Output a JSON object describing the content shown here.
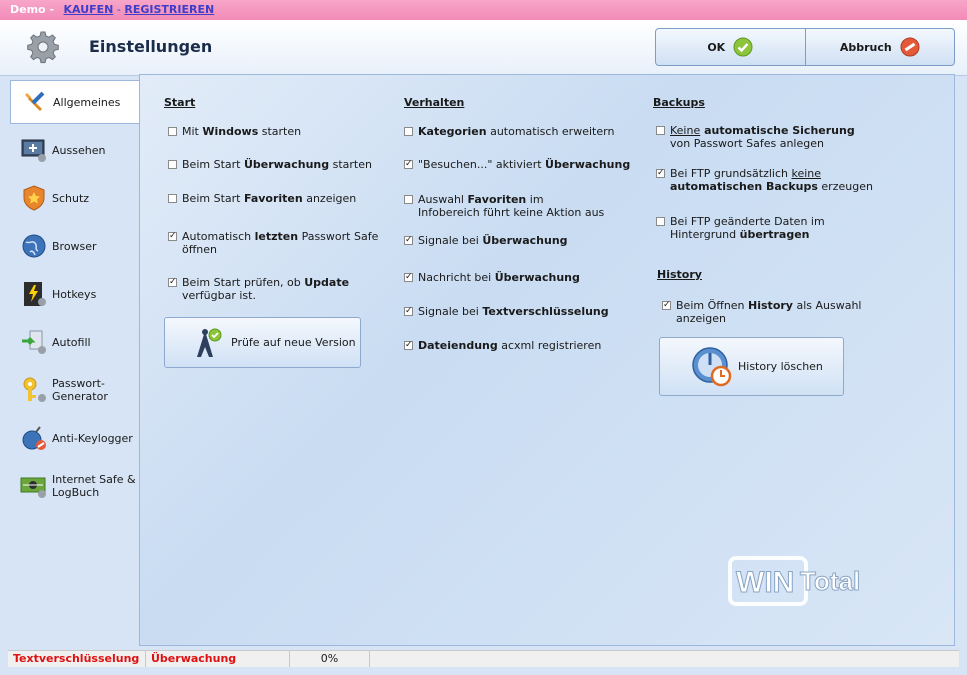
{
  "demo_bar": {
    "label": "Demo -",
    "buy": "KAUFEN",
    "sep": "-",
    "register": "REGISTRIEREN"
  },
  "header": {
    "title": "Einstellungen",
    "ok": "OK",
    "cancel": "Abbruch"
  },
  "sidebar": [
    {
      "label": "Allgemeines",
      "icon": "tools-icon",
      "active": true
    },
    {
      "label": "Aussehen",
      "icon": "monitor-icon"
    },
    {
      "label": "Schutz",
      "icon": "shield-icon"
    },
    {
      "label": "Browser",
      "icon": "globe-icon"
    },
    {
      "label": "Hotkeys",
      "icon": "keyboard-icon"
    },
    {
      "label": "Autofill",
      "icon": "autofill-icon"
    },
    {
      "label": "Passwort-\nGenerator",
      "icon": "key-icon"
    },
    {
      "label": "Anti-Keylogger",
      "icon": "bomb-icon"
    },
    {
      "label": "Internet Safe &\nLogBuch",
      "icon": "safe-icon"
    }
  ],
  "start": {
    "title": "Start",
    "o1": {
      "a": "Mit ",
      "b": "Windows",
      "c": " starten",
      "checked": false
    },
    "o2": {
      "a": "Beim Start ",
      "b": "Überwachung",
      "c": " starten",
      "checked": false
    },
    "o3": {
      "a": "Beim Start ",
      "b": "Favoriten",
      "c": " anzeigen",
      "checked": false
    },
    "o4": {
      "a": "Automatisch ",
      "b": "letzten",
      "c": " Passwort Safe",
      "d": "öffnen",
      "checked": true
    },
    "o5": {
      "a": "Beim Start prüfen, ob ",
      "b": "Update",
      "c": "verfügbar ist.",
      "checked": true
    },
    "check_button": "Prüfe auf neue Version"
  },
  "verhalten": {
    "title": "Verhalten",
    "o1": {
      "a": "Kategorien",
      "b": " automatisch erweitern",
      "checked": false
    },
    "o2": {
      "a": "\"Besuchen...\" aktiviert ",
      "b": "Überwachung",
      "checked": true
    },
    "o3": {
      "a": "Auswahl ",
      "b": "Favoriten",
      "c": " im",
      "d": "Infobereich führt keine Aktion aus",
      "checked": false
    },
    "o4": {
      "a": "Signale bei ",
      "b": "Überwachung",
      "checked": true
    },
    "o5": {
      "a": "Nachricht bei ",
      "b": "Überwachung",
      "checked": true
    },
    "o6": {
      "a": "Signale bei ",
      "b": "Textverschlüsselung",
      "checked": true
    },
    "o7": {
      "a": "Dateiendung",
      "b": " acxml registrieren",
      "checked": true
    }
  },
  "backups": {
    "title": "Backups",
    "o1": {
      "a": "Keine",
      "b": " automatische Sicherung",
      "c": "von Passwort Safes anlegen",
      "checked": false
    },
    "o2": {
      "a": "Bei FTP grundsätzlich ",
      "b": "keine",
      "c": "automatischen Backups",
      "d": " erzeugen",
      "checked": true
    },
    "o3": {
      "a": "Bei FTP geänderte Daten im",
      "b": "Hintergrund ",
      "c": "übertragen",
      "checked": false
    }
  },
  "history": {
    "title": "History",
    "o1": {
      "a": "Beim Öffnen ",
      "b": "History",
      "c": " als Auswahl",
      "d": "anzeigen",
      "checked": true
    },
    "clear_button": "History löschen"
  },
  "logo": {
    "text1": "WIN",
    "text2": "Total"
  },
  "statusbar": {
    "s1": "Textverschlüsselung",
    "s2": "Überwachung",
    "progress": "0%"
  }
}
